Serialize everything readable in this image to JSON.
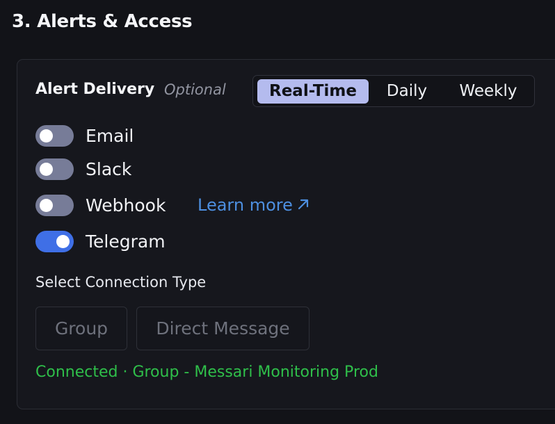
{
  "section": {
    "title": "3. Alerts & Access"
  },
  "delivery": {
    "title": "Alert Delivery",
    "optional": "Optional",
    "frequency_options": [
      "Real-Time",
      "Daily",
      "Weekly"
    ],
    "selected_frequency": "Real-Time"
  },
  "channels": [
    {
      "label": "Email",
      "enabled": false
    },
    {
      "label": "Slack",
      "enabled": false
    },
    {
      "label": "Webhook",
      "enabled": false,
      "link": "Learn more",
      "link_icon": "external-link-arrow-icon"
    },
    {
      "label": "Telegram",
      "enabled": true
    }
  ],
  "connection": {
    "label": "Select Connection Type",
    "options": [
      "Group",
      "Direct Message"
    ],
    "status": "Connected · Group - Messari Monitoring Prod"
  },
  "colors": {
    "toggle_on": "#3f6fe6",
    "toggle_off": "#777c98",
    "segment_active": "#b4bbee",
    "link": "#4d8fe0",
    "status": "#2fbf4a"
  }
}
